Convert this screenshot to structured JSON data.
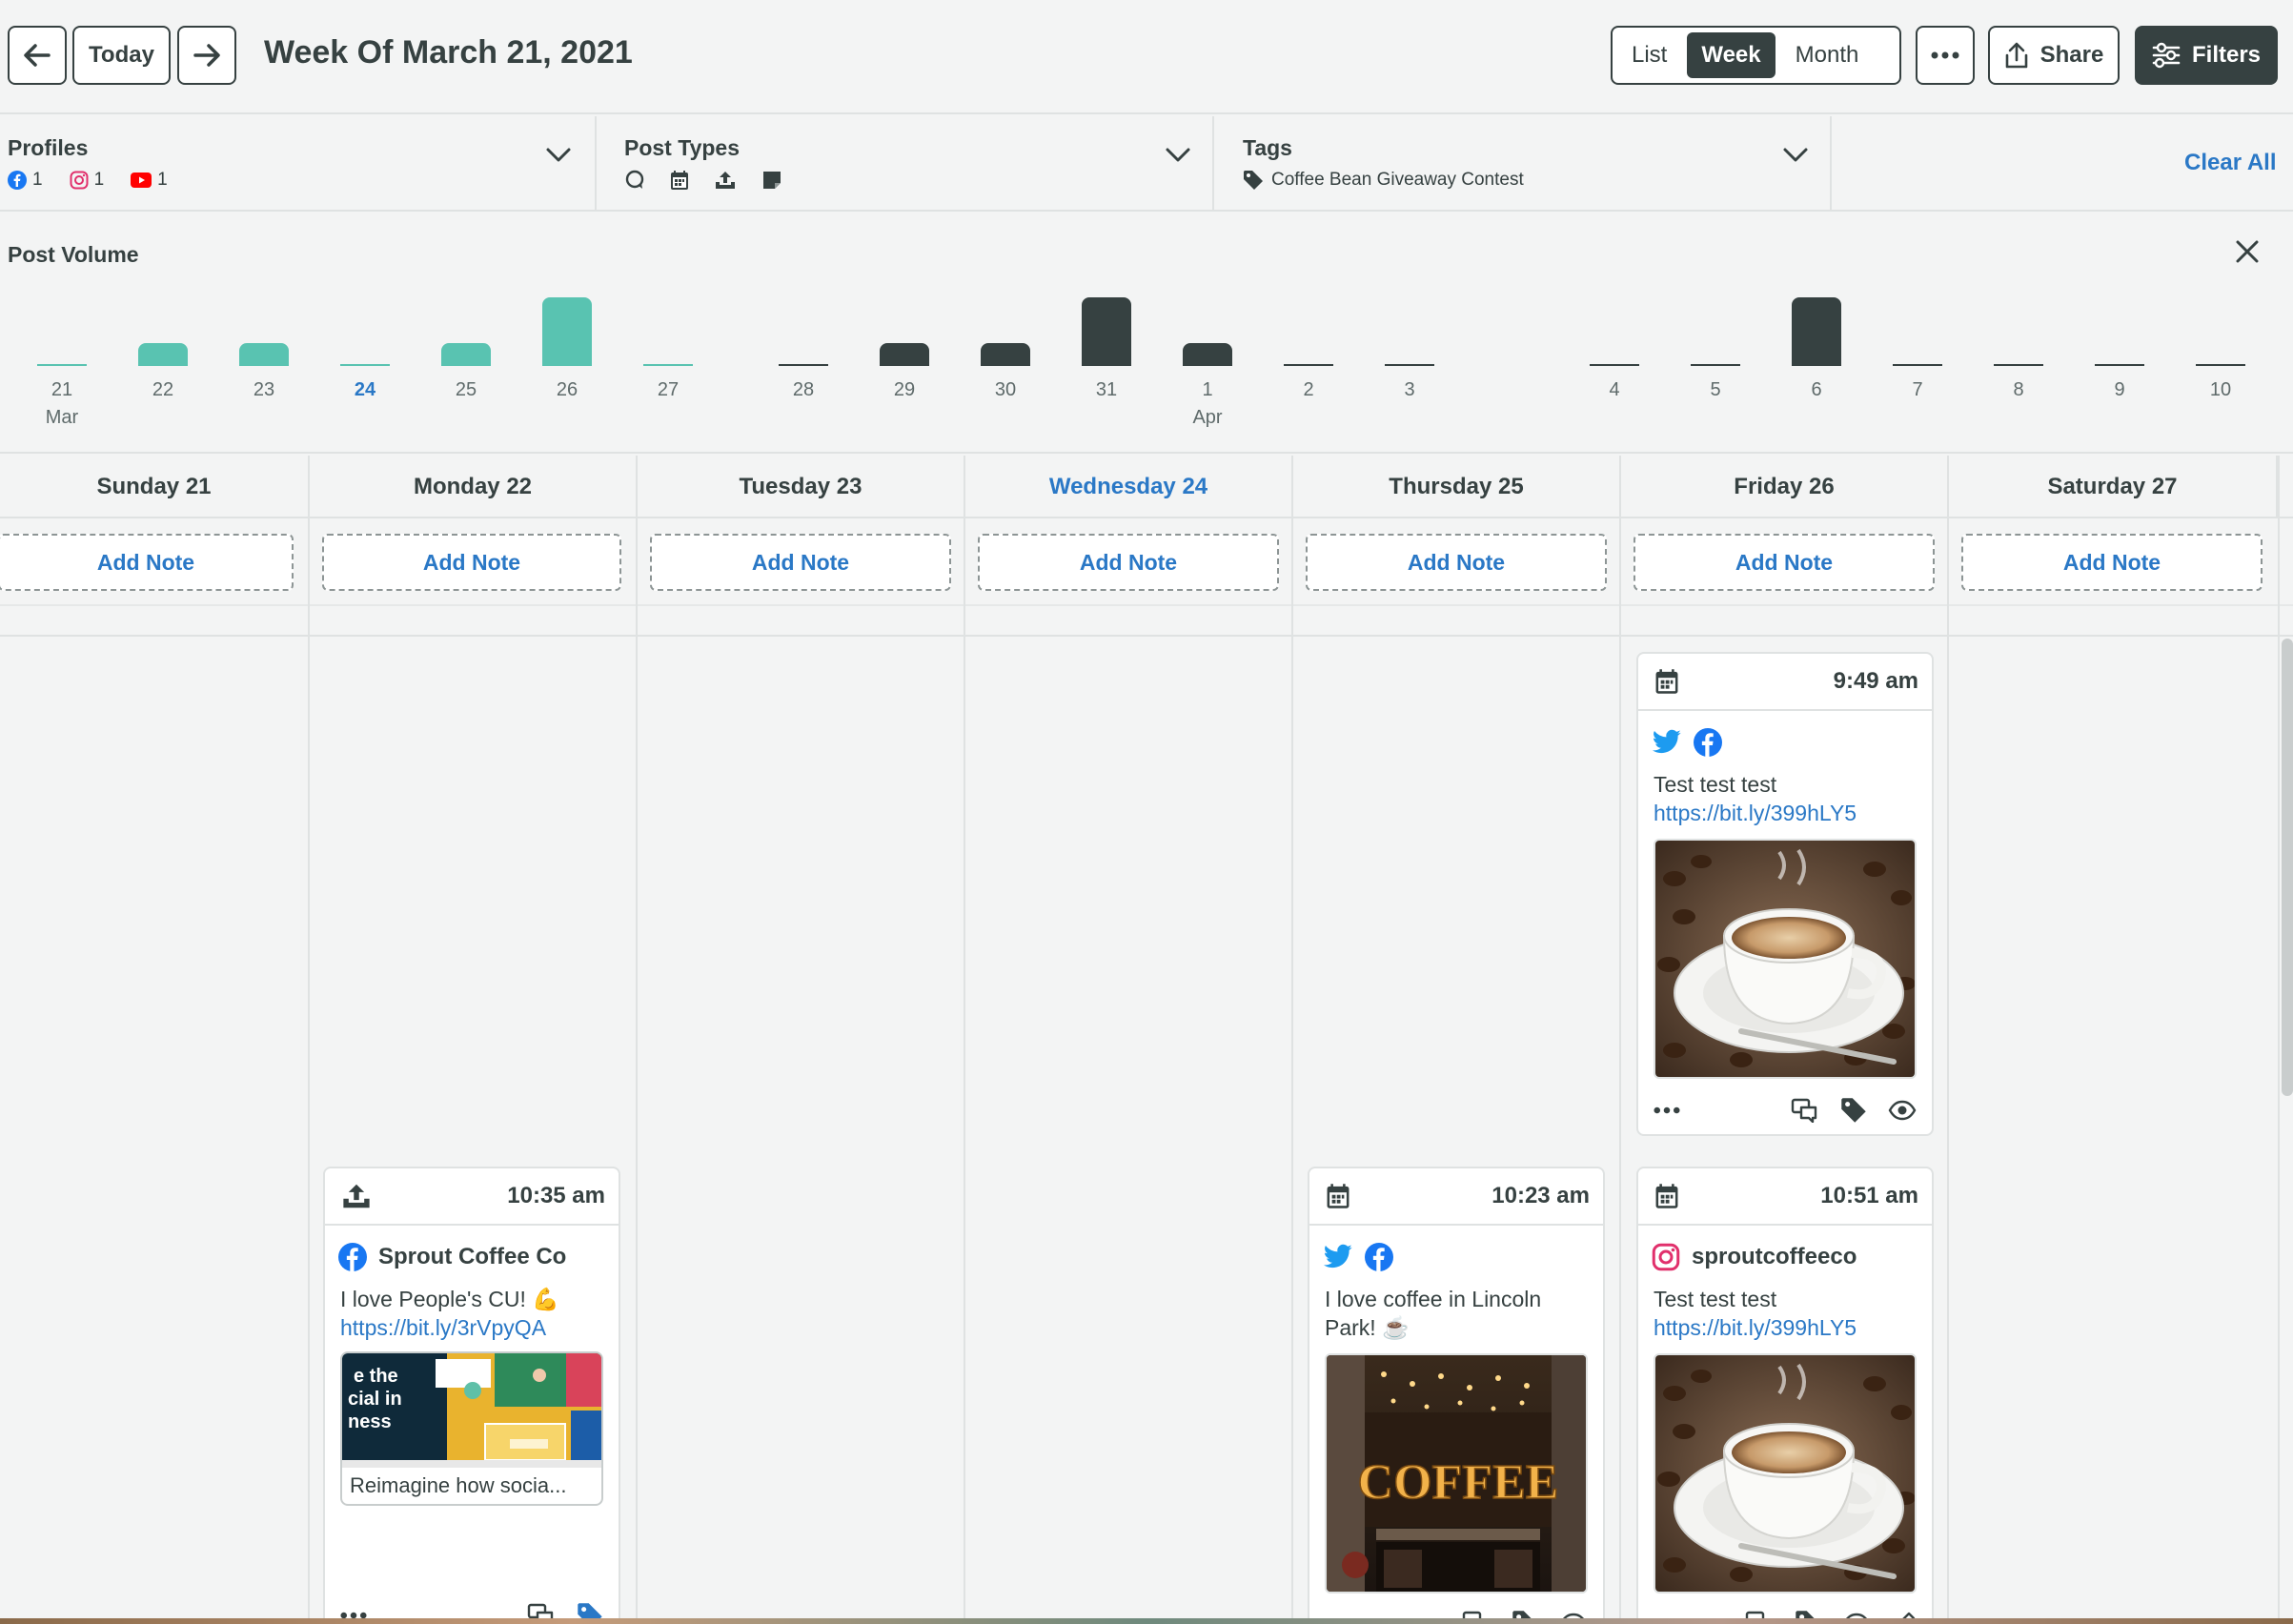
{
  "toolbar": {
    "today_label": "Today",
    "week_title": "Week Of March 21, 2021",
    "views": [
      "List",
      "Week",
      "Month"
    ],
    "active_view": "Week",
    "share_label": "Share",
    "filters_label": "Filters"
  },
  "filters": {
    "profiles_label": "Profiles",
    "profile_counts": {
      "facebook": "1",
      "instagram": "1",
      "youtube": "1"
    },
    "post_types_label": "Post Types",
    "tags_label": "Tags",
    "tag_value": "Coffee Bean Giveaway Contest",
    "clear_all": "Clear All"
  },
  "post_volume": {
    "title": "Post Volume"
  },
  "chart_data": {
    "type": "bar",
    "title": "Post Volume",
    "groups": [
      {
        "labels": [
          "21",
          "22",
          "23",
          "24",
          "25",
          "26",
          "27"
        ],
        "values": [
          0,
          1,
          1,
          0,
          1,
          3,
          0
        ],
        "color": "#59c3b1",
        "month_label": {
          "index": 0,
          "text": "Mar"
        }
      },
      {
        "labels": [
          "28",
          "29",
          "30",
          "31",
          "1",
          "2",
          "3"
        ],
        "values": [
          0,
          1,
          1,
          3,
          1,
          0,
          0
        ],
        "color": "#364141",
        "month_label": {
          "index": 4,
          "text": "Apr"
        }
      },
      {
        "labels": [
          "4",
          "5",
          "6",
          "7",
          "8",
          "9",
          "10"
        ],
        "values": [
          0,
          0,
          3,
          0,
          0,
          0,
          0
        ],
        "color": "#364141"
      }
    ],
    "highlighted_label": "24"
  },
  "days": [
    {
      "name": "Sunday 21",
      "today": false
    },
    {
      "name": "Monday 22",
      "today": false
    },
    {
      "name": "Tuesday 23",
      "today": false
    },
    {
      "name": "Wednesday 24",
      "today": true
    },
    {
      "name": "Thursday 25",
      "today": false
    },
    {
      "name": "Friday 26",
      "today": false
    },
    {
      "name": "Saturday 27",
      "today": false
    }
  ],
  "add_note_label": "Add Note",
  "posts": {
    "fri_949": {
      "time": "9:49 am",
      "text": "Test test test",
      "link": "https://bit.ly/399hLY5",
      "networks": [
        "twitter-icon",
        "facebook-icon"
      ]
    },
    "mon_1035": {
      "time": "10:35 am",
      "profile": "Sprout Coffee Co",
      "text": "I love People's CU! 💪",
      "link": "https://bit.ly/3rVpyQA",
      "preview_caption": "Reimagine how socia...",
      "preview_image_text": "e the\ncial in\nness"
    },
    "thu_1023": {
      "time": "10:23 am",
      "text": "I love coffee in Lincoln Park! ☕",
      "image_sign": "COFFEE",
      "networks": [
        "twitter-icon",
        "facebook-icon"
      ]
    },
    "fri_1051": {
      "time": "10:51 am",
      "profile": "sproutcoffeeco",
      "text": "Test test test",
      "link": "https://bit.ly/399hLY5"
    }
  },
  "colors": {
    "accent_blue": "#2a78c6",
    "teal": "#59c3b1",
    "dark": "#364141",
    "facebook": "#1877f2",
    "twitter": "#1d9bf0",
    "instagram": "#e1306c",
    "youtube": "#ff0000"
  }
}
